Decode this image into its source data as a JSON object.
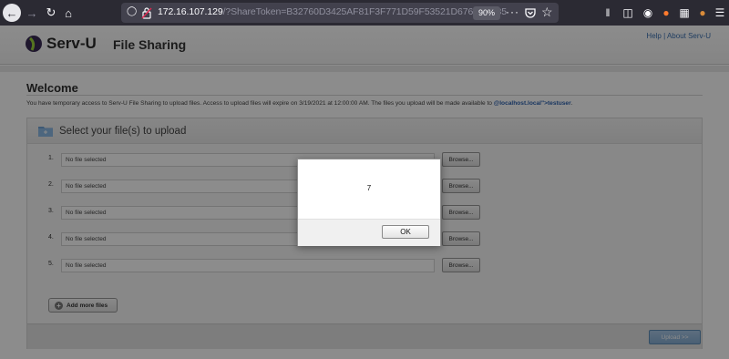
{
  "browser": {
    "url_host": "172.16.107.129",
    "url_rest": "/?ShareToken=B32760D3425AF81F3F771D59F53521D676E6E185",
    "zoom": "90%",
    "more": "···"
  },
  "header": {
    "logo": "Serv-U",
    "app_title": "File Sharing",
    "help_link": "Help",
    "separator": " | ",
    "about_link": "About Serv-U"
  },
  "welcome": {
    "title": "Welcome",
    "notice": "You have temporary access to Serv-U File Sharing to upload files. Access to upload files will expire on 3/19/2021 at 12:00:00 AM. The files you upload will be made available to ",
    "account": "@localhost.local\">testuser",
    "notice_end": "."
  },
  "upload_panel": {
    "title": "Select your file(s) to upload",
    "rows": [
      {
        "num": "1.",
        "value": "No file selected",
        "button": "Browse..."
      },
      {
        "num": "2.",
        "value": "No file selected",
        "button": "Browse..."
      },
      {
        "num": "3.",
        "value": "No file selected",
        "button": "Browse..."
      },
      {
        "num": "4.",
        "value": "No file selected",
        "button": "Browse..."
      },
      {
        "num": "5.",
        "value": "No file selected",
        "button": "Browse..."
      }
    ],
    "add_more": "Add more files",
    "upload_button": "Upload >>"
  },
  "dialog": {
    "message": "7",
    "ok": "OK"
  },
  "colors": {
    "toolbar_bg": "#2b2a33",
    "urlbar_bg": "#42414d",
    "link": "#2f63b0",
    "upload_btn": "#86aed4"
  }
}
